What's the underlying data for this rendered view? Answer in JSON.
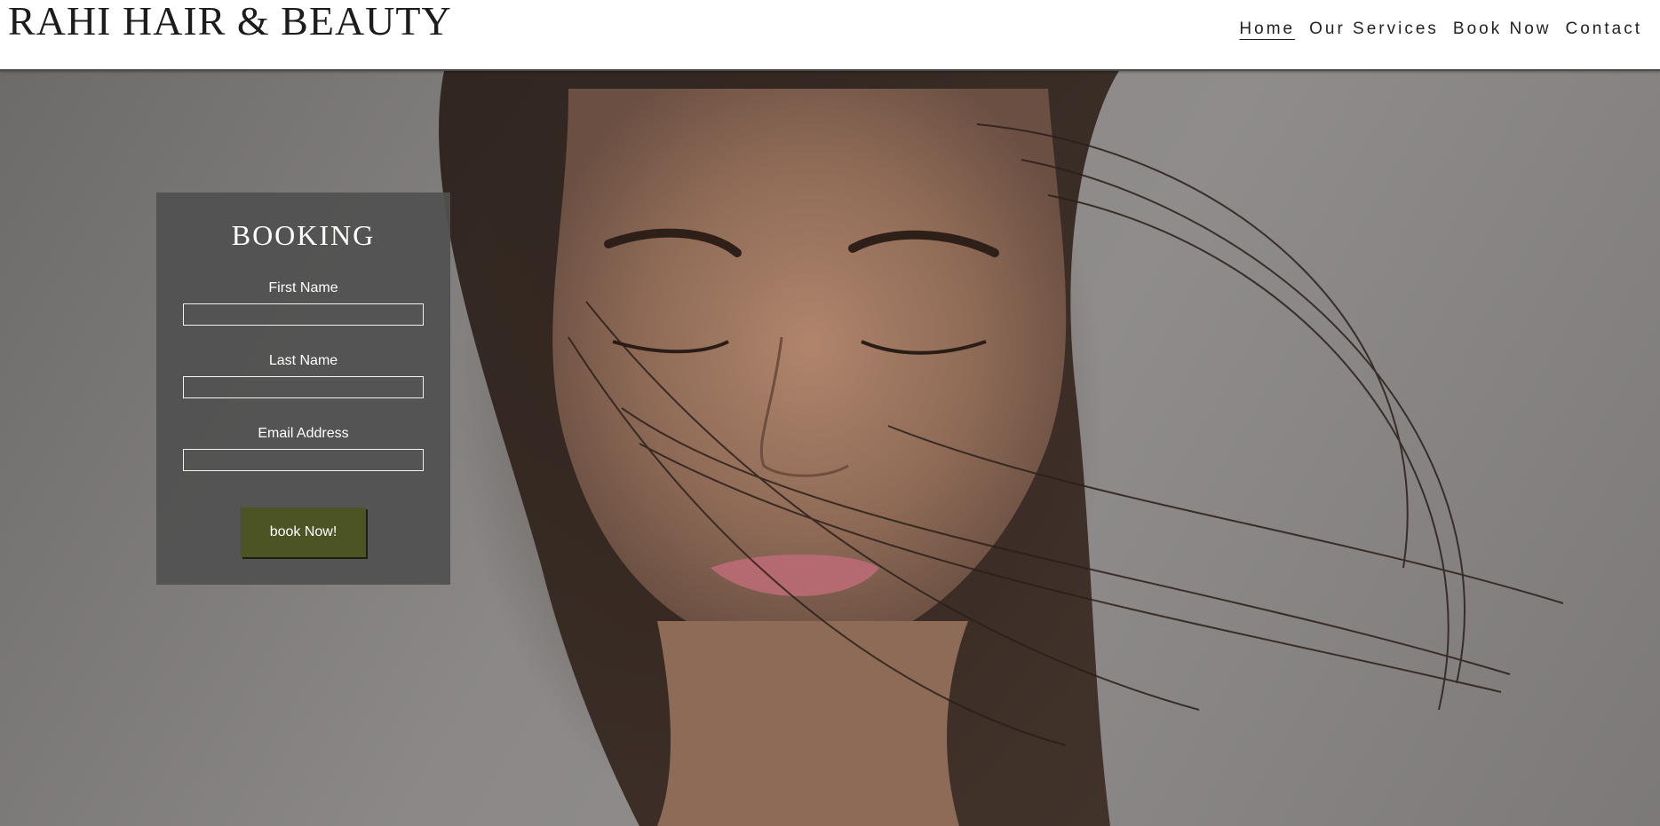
{
  "header": {
    "brand": "RAHI HAIR & BEAUTY",
    "nav": [
      {
        "label": "Home",
        "active": true
      },
      {
        "label": "Our Services",
        "active": false
      },
      {
        "label": "Book Now",
        "active": false
      },
      {
        "label": "Contact",
        "active": false
      }
    ]
  },
  "booking": {
    "title": "BOOKING",
    "fields": [
      {
        "label": "First Name",
        "value": ""
      },
      {
        "label": "Last Name",
        "value": ""
      },
      {
        "label": "Email Address",
        "value": ""
      }
    ],
    "submit_label": "book Now!"
  },
  "hero": {
    "image": "woman-with-windswept-hair-photo"
  },
  "colors": {
    "header_bg": "#ffffff",
    "panel_bg": "#505050",
    "button_bg": "#4d5424",
    "text_light": "#ffffff",
    "text_dark": "#1c1c1c"
  }
}
